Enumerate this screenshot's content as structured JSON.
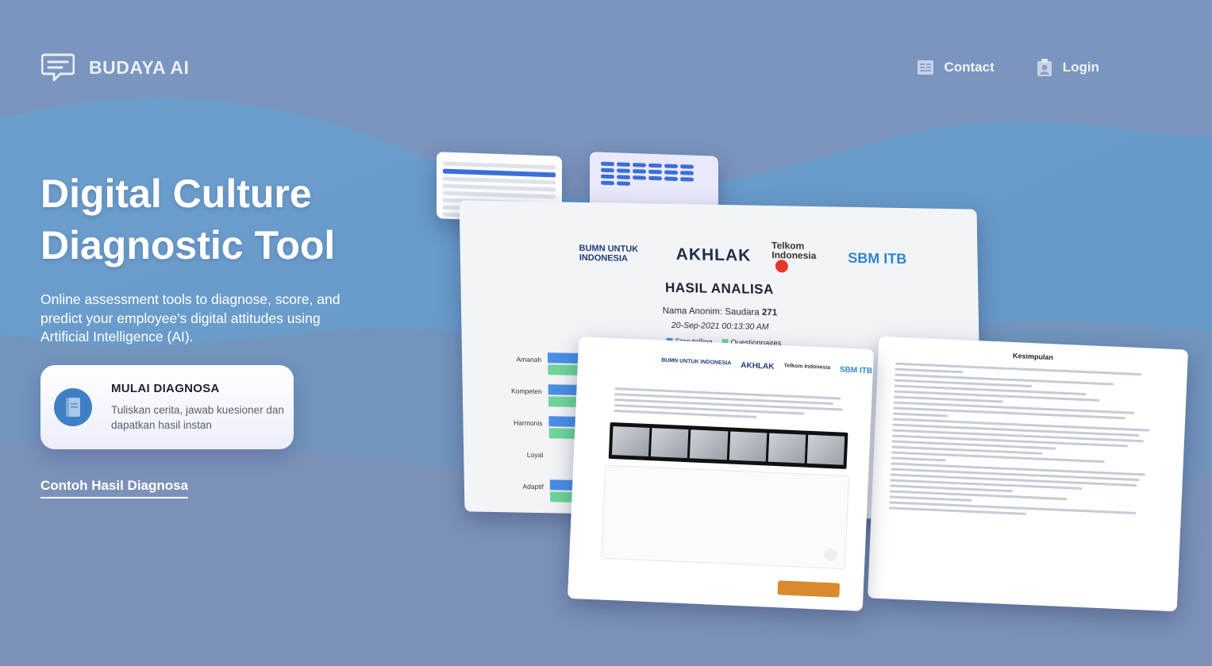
{
  "brand": {
    "name": "BUDAYA AI",
    "icon": "chat-bubble-icon"
  },
  "nav": [
    {
      "label": "Contact",
      "icon": "contact-card-icon"
    },
    {
      "label": "Login",
      "icon": "user-badge-icon"
    }
  ],
  "hero": {
    "title_line1": "Digital Culture",
    "title_line2": "Diagnostic Tool",
    "subtitle": "Online assessment tools to diagnose, score, and predict your employee's digital attitudes using Artificial Intelligence (AI)."
  },
  "cta": {
    "title": "MULAI DIAGNOSA",
    "description": "Tuliskan cerita, jawab kuesioner dan dapatkan hasil instan",
    "icon": "book-icon"
  },
  "example_link": "Contoh Hasil Diagnosa",
  "mockup": {
    "logos": [
      "BUMN UNTUK INDONESIA",
      "AKHLAK",
      "Telkom Indonesia",
      "SBM ITB"
    ],
    "report_title": "HASIL ANALISA",
    "anon_label": "Nama Anonim: Saudara",
    "anon_number": "271",
    "date": "20-Sep-2021 00:13:30 AM",
    "legend": [
      "Storytelling",
      "Questionnaires"
    ],
    "bar_categories": [
      "Amanah",
      "Kompeten",
      "Harmonis",
      "Loyal",
      "Adaptif"
    ],
    "summary_title": "Kesimpulan"
  },
  "colors": {
    "accent_blue": "#3f7fc6",
    "storytelling": "#4a8ee6",
    "questionnaires": "#6fd69a",
    "button_orange": "#d88a2c"
  }
}
